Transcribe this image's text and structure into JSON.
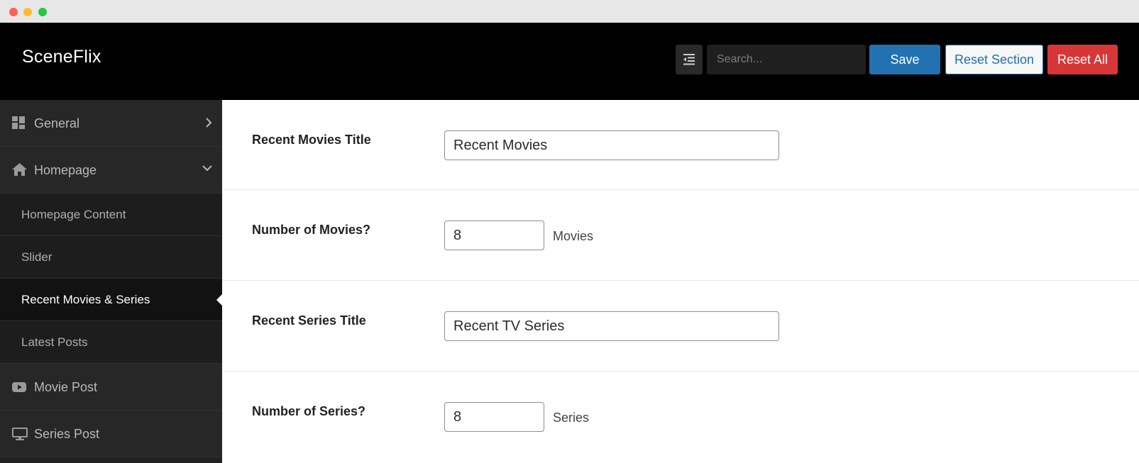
{
  "header": {
    "brand": "SceneFlix",
    "search_placeholder": "Search...",
    "save_label": "Save",
    "reset_section_label": "Reset Section",
    "reset_all_label": "Reset All"
  },
  "sidebar": {
    "items": [
      {
        "label": "General",
        "icon": "grid-icon",
        "chevron": "chevron-right-icon"
      },
      {
        "label": "Homepage",
        "icon": "home-icon",
        "chevron": "chevron-down-icon"
      },
      {
        "label": "Homepage Content"
      },
      {
        "label": "Slider"
      },
      {
        "label": "Recent Movies & Series",
        "active": true
      },
      {
        "label": "Latest Posts"
      },
      {
        "label": "Movie Post",
        "icon": "youtube-icon"
      },
      {
        "label": "Series Post",
        "icon": "monitor-icon"
      }
    ]
  },
  "fields": {
    "recent_movies_title": {
      "label": "Recent Movies Title",
      "value": "Recent Movies"
    },
    "number_of_movies": {
      "label": "Number of Movies?",
      "value": "8",
      "unit": "Movies"
    },
    "recent_series_title": {
      "label": "Recent Series Title",
      "value": "Recent TV Series"
    },
    "number_of_series": {
      "label": "Number of Series?",
      "value": "8",
      "unit": "Series"
    }
  },
  "colors": {
    "header_bg": "#000000",
    "sidebar_bg": "#222222",
    "save": "#2271b1",
    "reset_all": "#d63638"
  }
}
